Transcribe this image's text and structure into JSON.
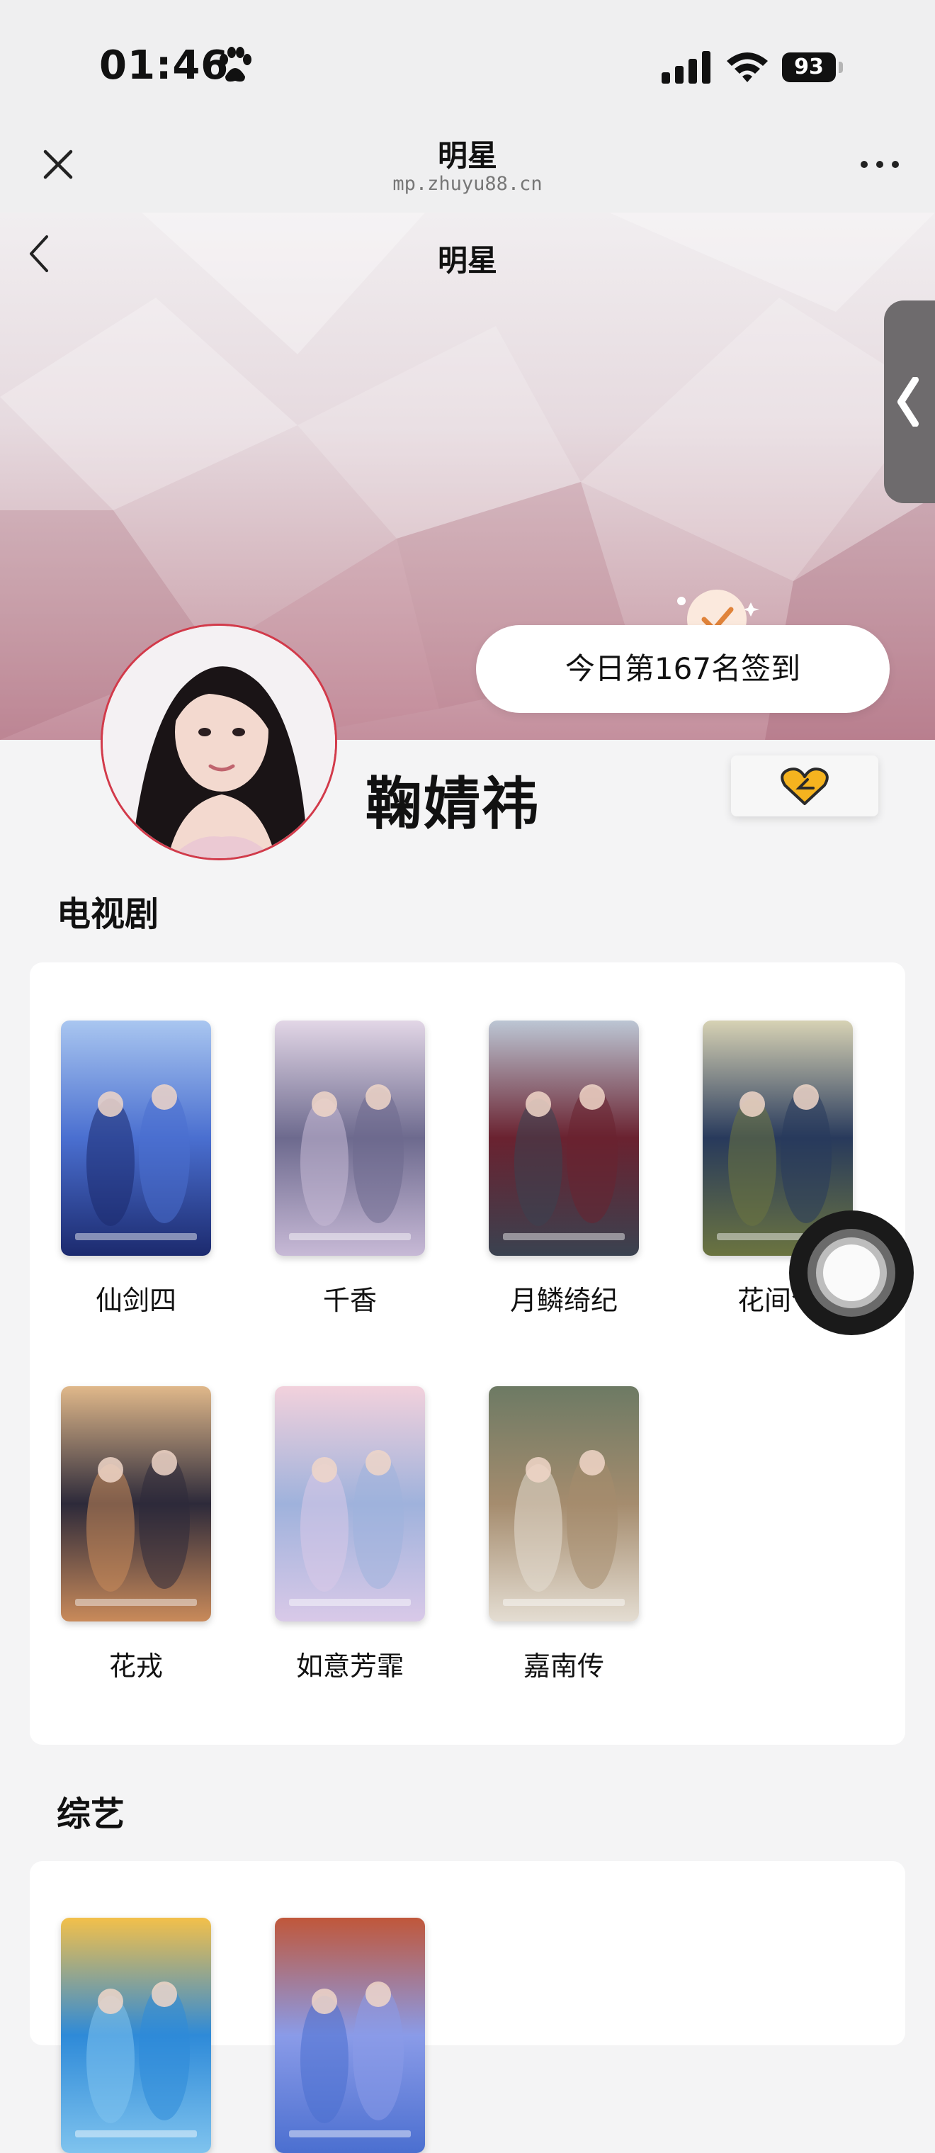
{
  "status_bar": {
    "time": "01:46",
    "battery": "93"
  },
  "nav": {
    "title": "明星",
    "subtitle": "mp.zhuyu88.cn"
  },
  "page": {
    "title": "明星"
  },
  "checkin": {
    "text": "今日第167名签到"
  },
  "star": {
    "name": "鞠婧祎"
  },
  "sections": {
    "tv": {
      "title": "电视剧",
      "items": [
        {
          "title": "仙剑四",
          "colors": [
            "#1c2a6e",
            "#4a6fd0",
            "#a9c6f0"
          ]
        },
        {
          "title": "千香",
          "colors": [
            "#c7b9d6",
            "#6d6a8e",
            "#e2d6e6"
          ]
        },
        {
          "title": "月鳞绮纪",
          "colors": [
            "#3a4250",
            "#6a2230",
            "#bcc6d4"
          ]
        },
        {
          "title": "花间令",
          "colors": [
            "#6b7440",
            "#283a5c",
            "#d7d2b4"
          ]
        },
        {
          "title": "花戎",
          "colors": [
            "#c98a5a",
            "#2d2a3a",
            "#e0b88a"
          ]
        },
        {
          "title": "如意芳霏",
          "colors": [
            "#d9c9e8",
            "#9fb2dc",
            "#f2d1dc"
          ]
        },
        {
          "title": "嘉南传",
          "colors": [
            "#e4ddd2",
            "#a58c6e",
            "#6d7a64"
          ]
        }
      ]
    },
    "variety": {
      "title": "综艺",
      "items": [
        {
          "title": "",
          "colors": [
            "#7fc3ee",
            "#2e8ad8",
            "#f3c04a"
          ]
        },
        {
          "title": "",
          "colors": [
            "#4b6fd0",
            "#8a9be8",
            "#c0573a"
          ]
        }
      ]
    }
  },
  "icons": {
    "close": "close-icon",
    "more": "more-icon",
    "back": "chevron-left-icon",
    "follow": "heart-icon",
    "check": "check-icon"
  },
  "colors": {
    "accent": "#e0833a",
    "heart": "#f5b31f",
    "avatar_border": "#d23a4a"
  }
}
